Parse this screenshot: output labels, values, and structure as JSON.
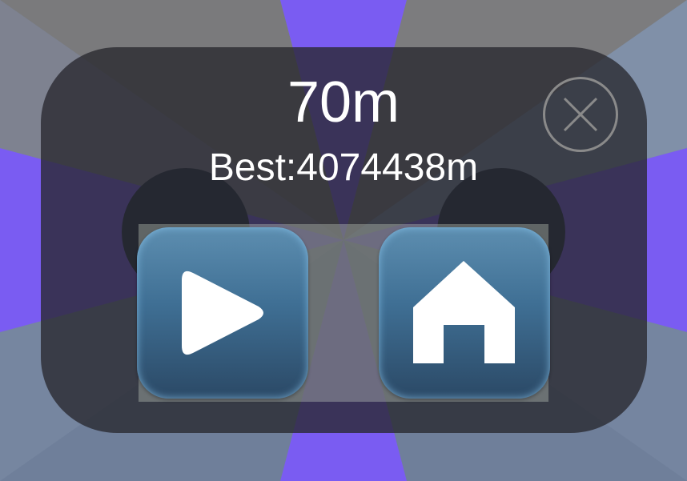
{
  "hud": {
    "distance": "70m",
    "best": "Best:4074438m"
  },
  "icons": {
    "close": "close-icon",
    "play": "play-icon",
    "home": "home-icon"
  },
  "colors": {
    "ray_purple": "#7a5cf2",
    "ray_gray": "#7d7d7d",
    "ray_blue": "#6e7fa0",
    "panel": "#2d2d33",
    "button_top": "#5d8eb0",
    "button_bottom": "#2b4966"
  }
}
